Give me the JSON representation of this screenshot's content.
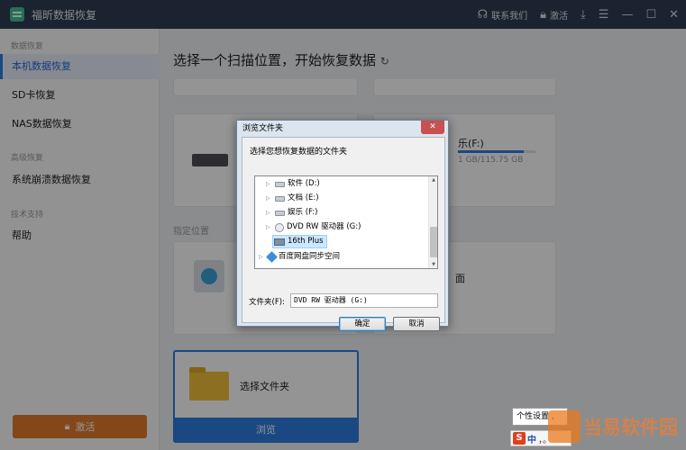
{
  "app": {
    "title": "福昕数据恢复",
    "contact_label": "联系我们",
    "activate_label": "激活"
  },
  "sidebar": {
    "sections": [
      {
        "heading": "数据恢复",
        "items": [
          "本机数据恢复",
          "SD卡恢复",
          "NAS数据恢复"
        ]
      },
      {
        "heading": "高级恢复",
        "items": [
          "系统崩溃数据恢复"
        ]
      },
      {
        "heading": "技术支持",
        "items": [
          "帮助"
        ]
      }
    ],
    "active_item": "本机数据恢复",
    "activate_button": "激活"
  },
  "main": {
    "title": "选择一个扫描位置，开始恢复数据",
    "drive_right": {
      "label": "乐(F:)",
      "size": "1 GB/115.75 GB",
      "used_fraction": 0.85
    },
    "drive_left_size": "GB",
    "specified_section": "指定位置",
    "desktop_partial": "面",
    "folder_card": {
      "label": "选择文件夹",
      "browse": "浏览"
    }
  },
  "dialog": {
    "title": "浏览文件夹",
    "prompt": "选择您想恢复数据的文件夹",
    "tree": [
      {
        "label": "软件 (D:)",
        "icon": "drive-icon"
      },
      {
        "label": "文档 (E:)",
        "icon": "drive-icon"
      },
      {
        "label": "娱乐 (F:)",
        "icon": "drive-icon"
      },
      {
        "label": "DVD RW 驱动器 (G:)",
        "icon": "cd-drive-icon"
      },
      {
        "label": "16th Plus",
        "icon": "device-icon",
        "selected": true
      },
      {
        "label": "百度网盘同步空间",
        "icon": "cloud-icon"
      }
    ],
    "folder_label": "文件夹(F):",
    "folder_value": "DVD RW 驱动器 (G:)",
    "ok": "确定",
    "cancel": "取消"
  },
  "taskbar": {
    "tooltip": "个性设置",
    "ime": {
      "logo": "S",
      "mode": "中",
      "punct": "，。"
    }
  },
  "watermark": {
    "text": "当易软件园"
  }
}
